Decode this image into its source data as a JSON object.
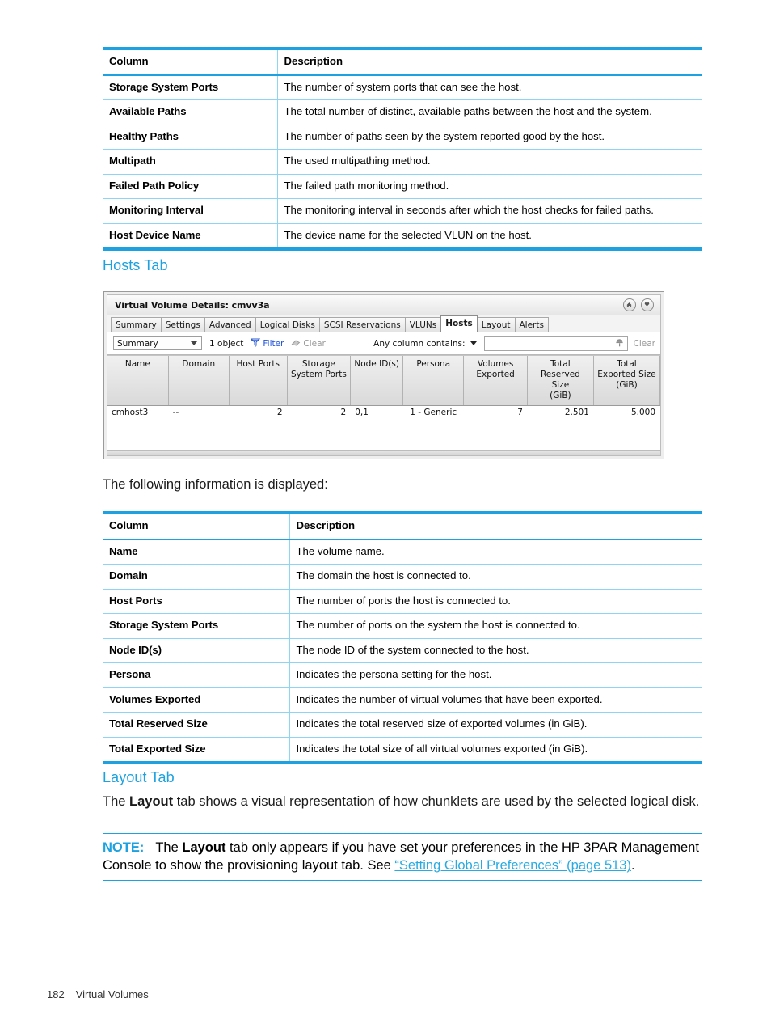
{
  "table1": {
    "headers": [
      "Column",
      "Description"
    ],
    "rows": [
      [
        "Storage System Ports",
        "The number of system ports that can see the host."
      ],
      [
        "Available Paths",
        "The total number of distinct, available paths between the host and the system."
      ],
      [
        "Healthy Paths",
        "The number of paths seen by the system reported good by the host."
      ],
      [
        "Multipath",
        "The used multipathing method."
      ],
      [
        "Failed Path Policy",
        "The failed path monitoring method."
      ],
      [
        "Monitoring Interval",
        "The monitoring interval in seconds after which the host checks for failed paths."
      ],
      [
        "Host Device Name",
        "The device name for the selected VLUN on the host."
      ]
    ]
  },
  "hosts_heading": "Hosts Tab",
  "screenshot": {
    "title": "Virtual Volume Details: cmvv3a",
    "collapse_icon": "chevron-up-circle-icon",
    "expand_icon": "chevron-down-circle-icon",
    "tabs": [
      {
        "label": "Summary",
        "active": false
      },
      {
        "label": "Settings",
        "active": false
      },
      {
        "label": "Advanced",
        "active": false
      },
      {
        "label": "Logical Disks",
        "active": false
      },
      {
        "label": "SCSI Reservations",
        "active": false
      },
      {
        "label": "VLUNs",
        "active": false
      },
      {
        "label": "Hosts",
        "active": true
      },
      {
        "label": "Layout",
        "active": false
      },
      {
        "label": "Alerts",
        "active": false
      }
    ],
    "toolbar": {
      "view_select_value": "Summary",
      "object_count": "1 object",
      "filter_label": "Filter",
      "clear_label": "Clear",
      "any_column_label": "Any column contains:",
      "search_value": "",
      "search_placeholder": "",
      "clear_right_label": "Clear"
    },
    "grid": {
      "columns": [
        "Name",
        "Domain",
        "Host Ports",
        "Storage System Ports",
        "Node ID(s)",
        "Persona",
        "Volumes Exported",
        "Total Reserved Size (GiB)",
        "Total Exported Size (GiB)"
      ],
      "rows": [
        {
          "name": "cmhost3",
          "domain": "--",
          "host_ports": "2",
          "storage_system_ports": "2",
          "node_ids": "0,1",
          "persona": "1 - Generic",
          "volumes_exported": "7",
          "total_reserved_size": "2.501",
          "total_exported_size": "5.000"
        }
      ]
    }
  },
  "intro_text": "The following information is displayed:",
  "table2": {
    "headers": [
      "Column",
      "Description"
    ],
    "rows": [
      [
        "Name",
        "The volume name."
      ],
      [
        "Domain",
        "The domain the host is connected to."
      ],
      [
        "Host Ports",
        "The number of ports the host is connected to."
      ],
      [
        "Storage System Ports",
        "The number of ports on the system the host is connected to."
      ],
      [
        "Node ID(s)",
        "The node ID of the system connected to the host."
      ],
      [
        "Persona",
        "Indicates the persona setting for the host."
      ],
      [
        "Volumes Exported",
        "Indicates the number of virtual volumes that have been exported."
      ],
      [
        "Total Reserved Size",
        "Indicates the total reserved size of exported volumes (in GiB)."
      ],
      [
        "Total Exported Size",
        "Indicates the total size of all virtual volumes exported (in GiB)."
      ]
    ]
  },
  "layout_heading": "Layout Tab",
  "layout_para": {
    "part1": "The ",
    "bold1": "Layout",
    "part2": " tab shows a visual representation of how chunklets are used by the selected logical disk."
  },
  "note": {
    "label": "NOTE:",
    "part1": "The ",
    "bold1": "Layout",
    "part2": " tab only appears if you have set your preferences in the HP 3PAR Management Console to show the provisioning layout tab. See ",
    "link": "“Setting Global Preferences” (page 513)",
    "part3": "."
  },
  "footer": {
    "page_number": "182",
    "section": "Virtual Volumes"
  },
  "colors": {
    "accent_blue": "#1da1e0",
    "table_rule": "#8fd4f2",
    "link_blue": "#29abe2"
  }
}
